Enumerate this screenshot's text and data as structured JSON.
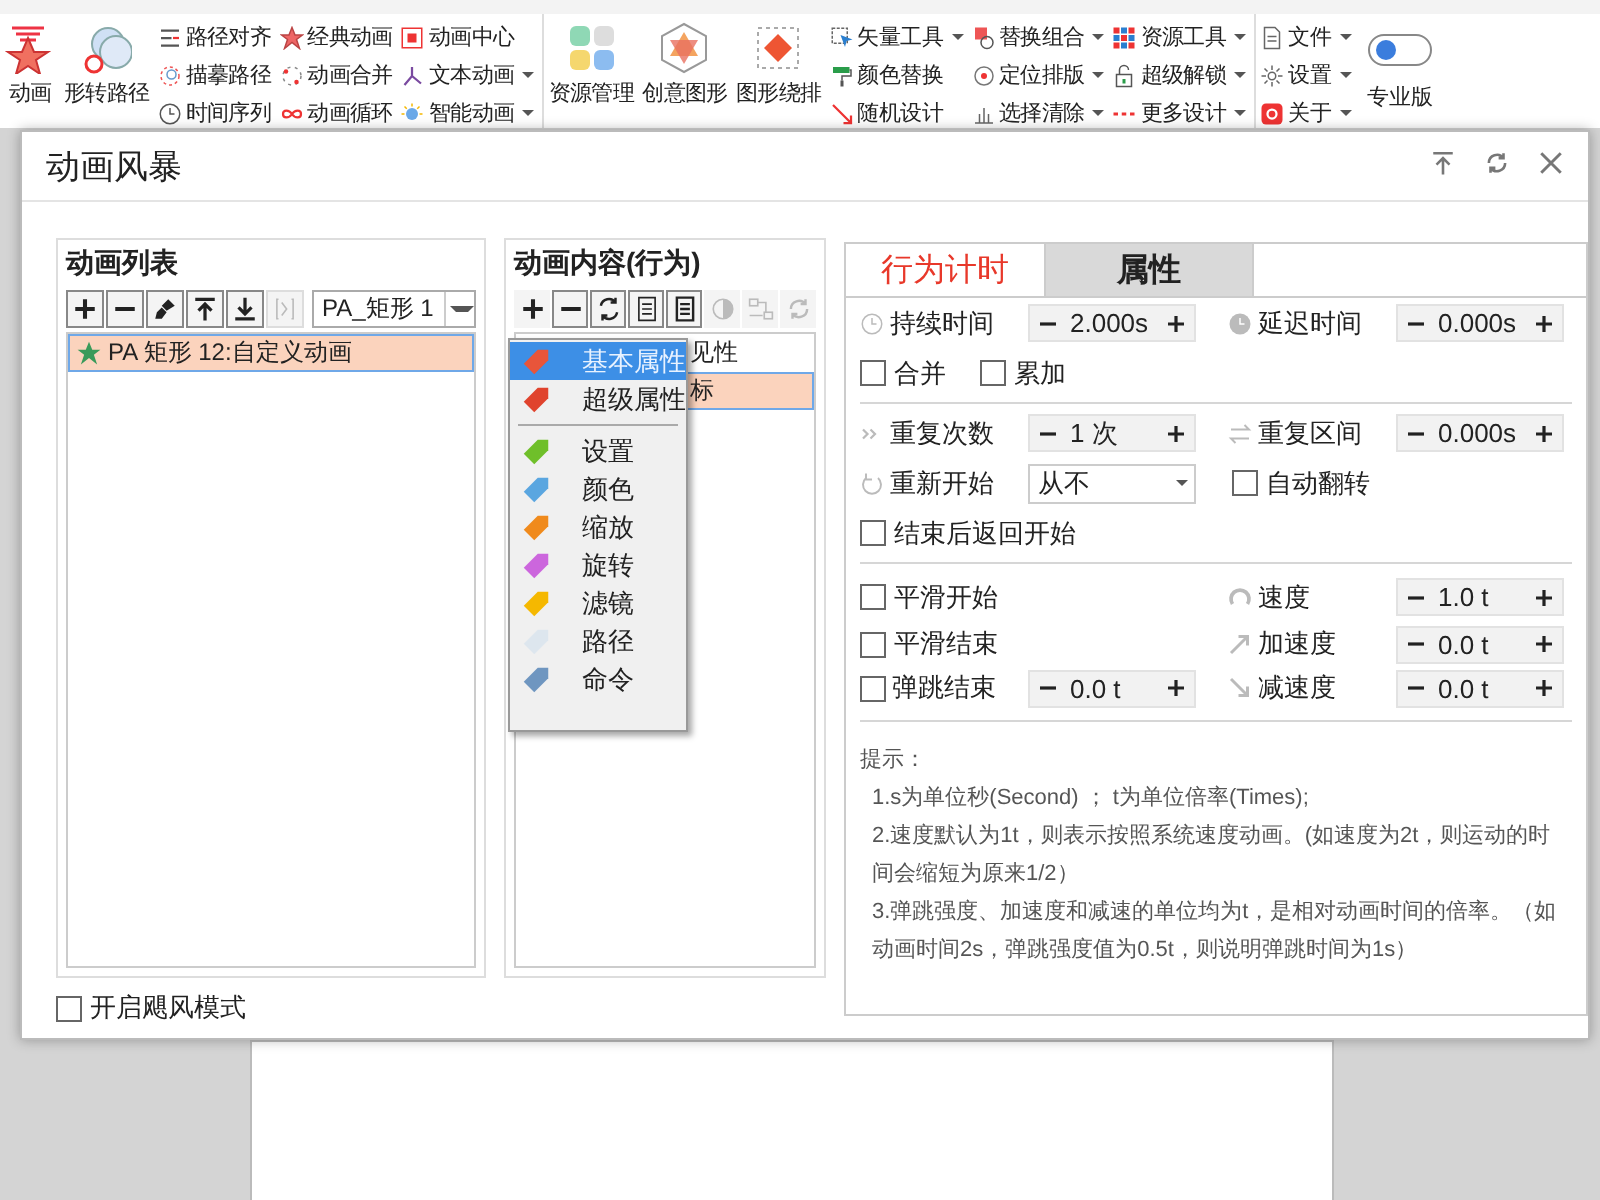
{
  "ribbon": {
    "sections": [
      {
        "large": [
          {
            "label": "动画"
          },
          {
            "label": "形转路径"
          }
        ],
        "columns": [
          [
            {
              "label": "路径对齐",
              "dropdown": false
            },
            {
              "label": "描摹路径",
              "dropdown": false
            },
            {
              "label": "时间序列",
              "dropdown": false
            }
          ],
          [
            {
              "label": "经典动画",
              "dropdown": false
            },
            {
              "label": "动画合并",
              "dropdown": false
            },
            {
              "label": "动画循环",
              "dropdown": false
            }
          ],
          [
            {
              "label": "动画中心",
              "dropdown": false
            },
            {
              "label": "文本动画",
              "dropdown": true
            },
            {
              "label": "智能动画",
              "dropdown": true
            }
          ]
        ]
      },
      {
        "large": [
          {
            "label": "资源管理"
          },
          {
            "label": "创意图形"
          },
          {
            "label": "图形绕排"
          }
        ],
        "columns": [
          [
            {
              "label": "矢量工具",
              "dropdown": true
            },
            {
              "label": "颜色替换",
              "dropdown": false
            },
            {
              "label": "随机设计",
              "dropdown": false
            }
          ],
          [
            {
              "label": "替换组合",
              "dropdown": true
            },
            {
              "label": "定位排版",
              "dropdown": true
            },
            {
              "label": "选择清除",
              "dropdown": true
            }
          ],
          [
            {
              "label": "资源工具",
              "dropdown": true
            },
            {
              "label": "超级解锁",
              "dropdown": true
            },
            {
              "label": "更多设计",
              "dropdown": true
            }
          ]
        ]
      },
      {
        "columns": [
          [
            {
              "label": "文件",
              "dropdown": true
            },
            {
              "label": "设置",
              "dropdown": true
            },
            {
              "label": "关于",
              "dropdown": true
            }
          ]
        ],
        "toggle": {
          "label": "专业版",
          "on": false
        }
      }
    ]
  },
  "dialog": {
    "title": "动画风暴",
    "animation_list": {
      "heading": "动画列表",
      "toolbar": [
        {
          "disabled": false
        },
        {
          "disabled": false
        },
        {
          "disabled": false
        },
        {
          "disabled": false
        },
        {
          "disabled": false
        },
        {
          "disabled": true
        }
      ],
      "selector": "PA_矩形 1",
      "items": [
        {
          "label": "PA  矩形 12:自定义动画",
          "selected": true
        }
      ]
    },
    "hurricane_mode": {
      "label": "开启飓风模式",
      "checked": false
    },
    "animation_content": {
      "heading": "动画内容(行为)",
      "toolbar": [
        {
          "disabled": false
        },
        {
          "disabled": false
        },
        {
          "disabled": false
        },
        {
          "disabled": false
        },
        {
          "disabled": false
        },
        {
          "disabled": true
        },
        {
          "disabled": true
        },
        {
          "disabled": true
        }
      ],
      "items": [
        {
          "label": "见性",
          "selected": false
        },
        {
          "label": "标",
          "selected": true
        }
      ],
      "menu": [
        {
          "kind": "item",
          "label": "基本属性",
          "color": "#e8553a",
          "selected": true
        },
        {
          "kind": "item",
          "label": "超级属性",
          "color": "#e0432d",
          "selected": false
        },
        {
          "kind": "separator"
        },
        {
          "kind": "item",
          "label": "设置",
          "color": "#6fbf2a",
          "selected": false
        },
        {
          "kind": "item",
          "label": "颜色",
          "color": "#5aa6e0",
          "selected": false
        },
        {
          "kind": "item",
          "label": "缩放",
          "color": "#f08a1c",
          "selected": false
        },
        {
          "kind": "item",
          "label": "旋转",
          "color": "#cc66dd",
          "selected": false
        },
        {
          "kind": "item",
          "label": "滤镜",
          "color": "#f5b800",
          "selected": false
        },
        {
          "kind": "item",
          "label": "路径",
          "color": "#dde6ee",
          "selected": false
        },
        {
          "kind": "item",
          "label": "命令",
          "color": "#6f96c0",
          "selected": false
        }
      ]
    },
    "tabs": [
      {
        "label": "行为计时",
        "selected": true
      },
      {
        "label": "属性",
        "selected": false
      }
    ],
    "timing": {
      "duration": {
        "label": "持续时间",
        "value": "2.000s"
      },
      "delay": {
        "label": "延迟时间",
        "value": "0.000s"
      },
      "merge": {
        "label": "合并",
        "checked": false
      },
      "accumulate": {
        "label": "累加",
        "checked": false
      },
      "repeat_count": {
        "label": "重复次数",
        "value": "1 次"
      },
      "repeat_interval": {
        "label": "重复区间",
        "value": "0.000s"
      },
      "restart": {
        "label": "重新开始",
        "value": "从不"
      },
      "auto_reverse": {
        "label": "自动翻转",
        "checked": false
      },
      "return_to_start": {
        "label": "结束后返回开始",
        "checked": false
      },
      "smooth_start": {
        "label": "平滑开始",
        "checked": false
      },
      "smooth_end": {
        "label": "平滑结束",
        "checked": false
      },
      "bounce_end": {
        "label": "弹跳结束",
        "checked": false,
        "value": "0.0 t"
      },
      "speed": {
        "label": "速度",
        "value": "1.0 t"
      },
      "acceleration": {
        "label": "加速度",
        "value": "0.0 t"
      },
      "deceleration": {
        "label": "减速度",
        "value": "0.0 t"
      }
    },
    "hints": {
      "title": "提示：",
      "lines": [
        "1.s为单位秒(Second) ； t为单位倍率(Times);",
        "2.速度默认为1t，则表示按照系统速度动画。(如速度为2t，则运动的时间会缩短为原来1/2）",
        "3.弹跳强度、加速度和减速的单位均为t，是相对动画时间的倍率。（如动画时间2s，弹跳强度值为0.5t，则说明弹跳时间为1s）"
      ]
    }
  }
}
